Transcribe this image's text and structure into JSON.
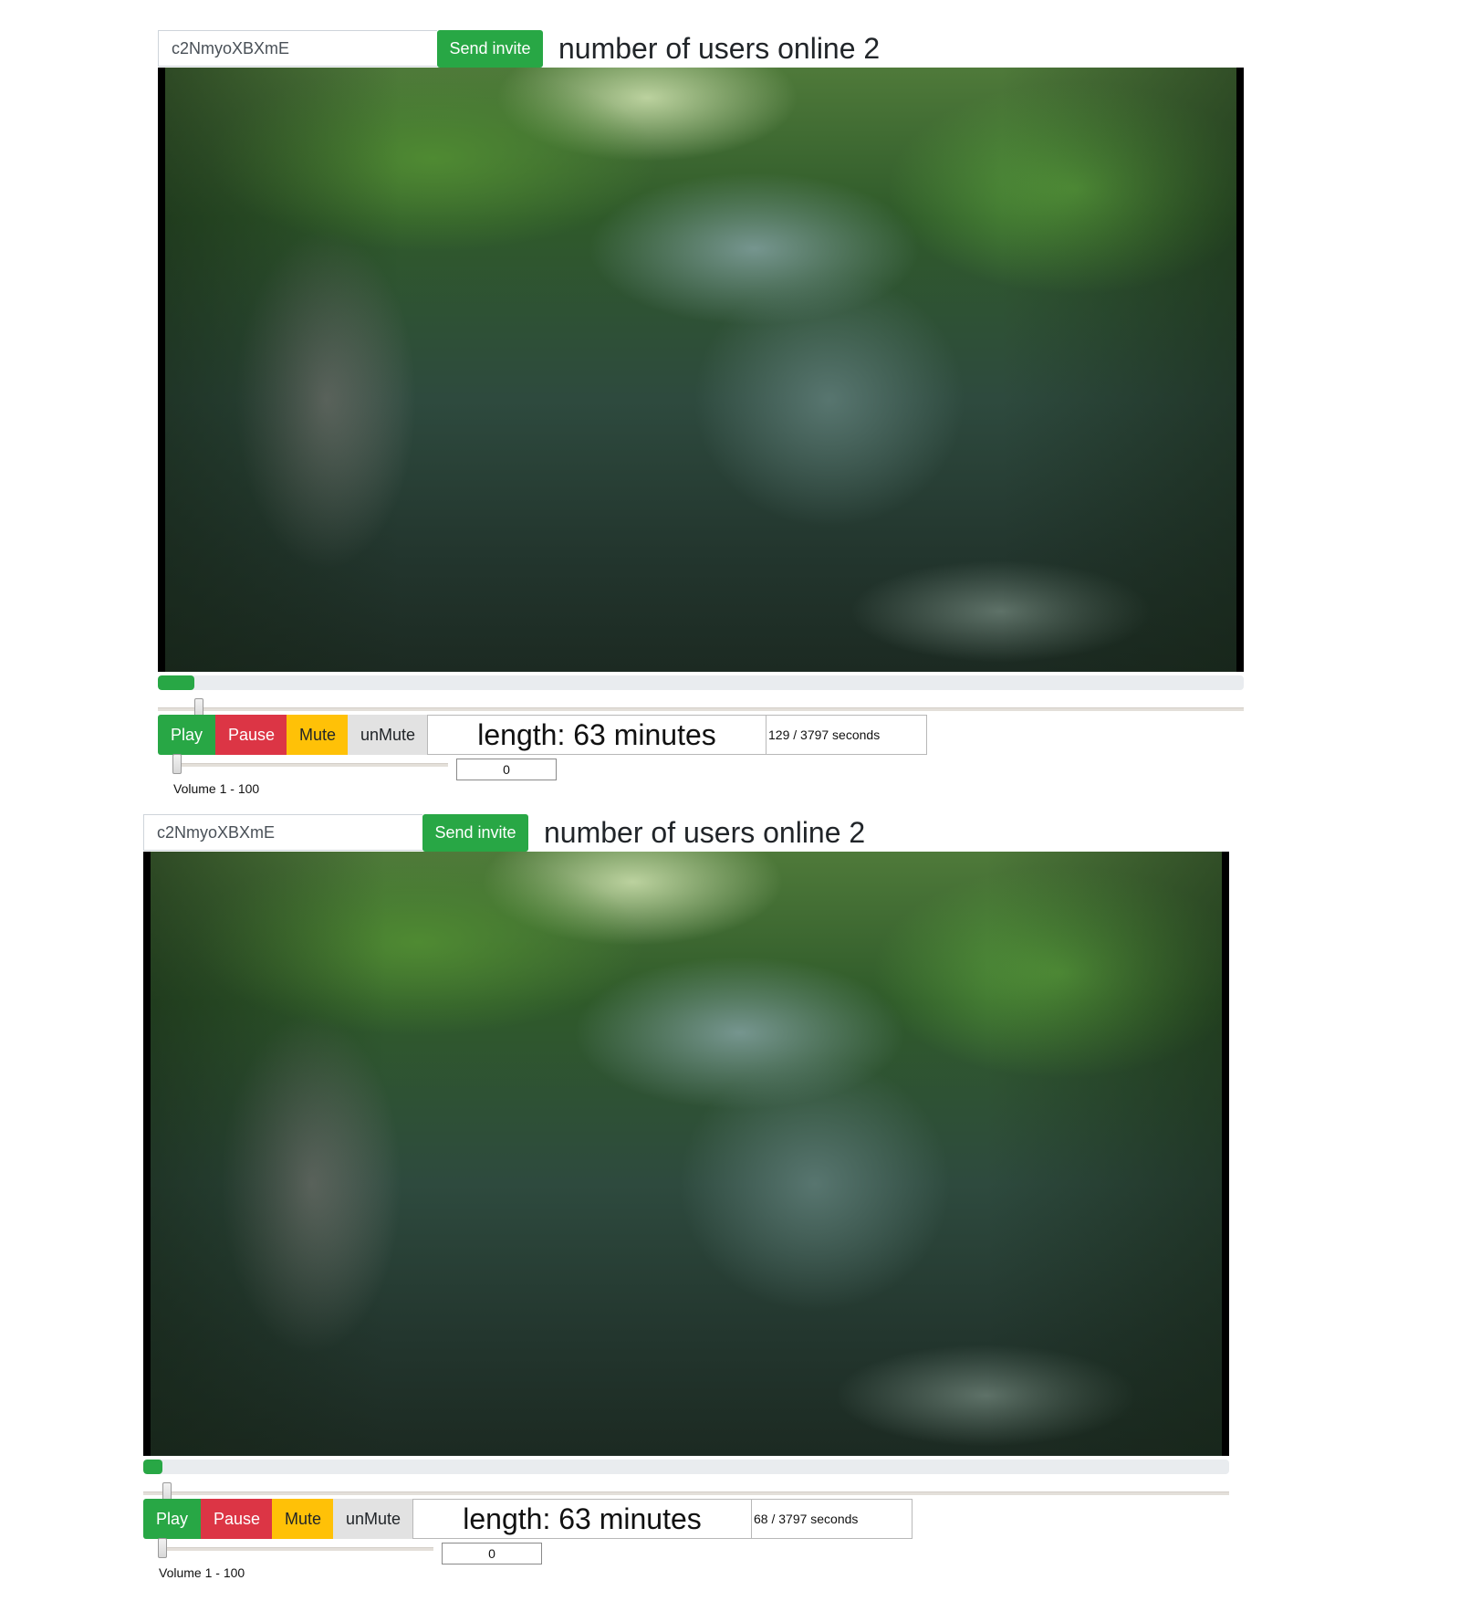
{
  "players": [
    {
      "invite_code": "c2NmyoXBXmE",
      "send_invite_label": "Send invite",
      "users_online": "number of users online 2",
      "progress_fraction": 0.034,
      "seek_fraction": 0.034,
      "buttons": {
        "play": "Play",
        "pause": "Pause",
        "mute": "Mute",
        "unmute": "unMute"
      },
      "length_text": "length: 63 minutes",
      "time_text": "129 / 3797 seconds",
      "volume_value": "0",
      "volume_fraction": 0.0,
      "volume_label": "Volume 1 - 100"
    },
    {
      "invite_code": "c2NmyoXBXmE",
      "send_invite_label": "Send invite",
      "users_online": "number of users online 2",
      "progress_fraction": 0.018,
      "seek_fraction": 0.018,
      "buttons": {
        "play": "Play",
        "pause": "Pause",
        "mute": "Mute",
        "unmute": "unMute"
      },
      "length_text": "length: 63 minutes",
      "time_text": "68 / 3797 seconds",
      "volume_value": "0",
      "volume_fraction": 0.0,
      "volume_label": "Volume 1 - 100"
    }
  ]
}
